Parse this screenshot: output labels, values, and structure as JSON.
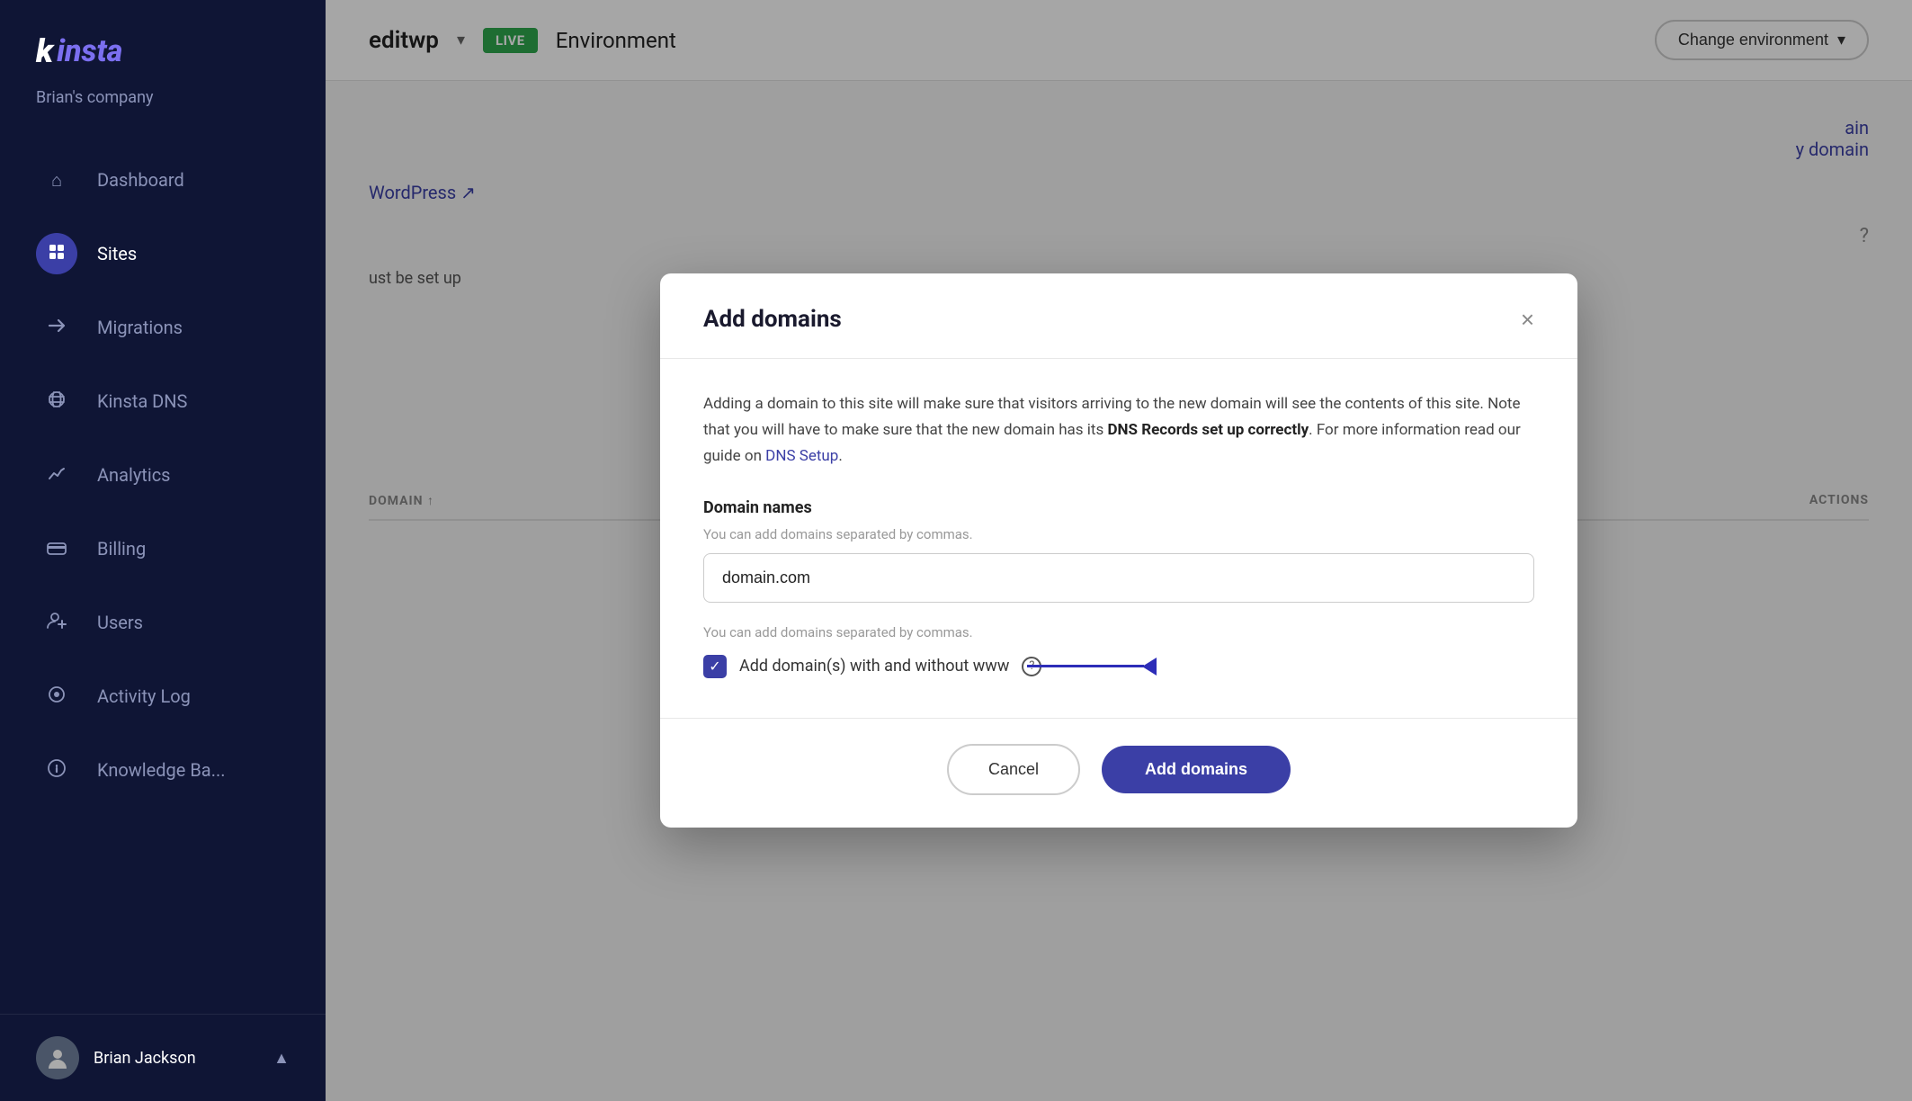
{
  "sidebar": {
    "logo": "Kinsta",
    "company": "Brian's company",
    "nav_items": [
      {
        "id": "dashboard",
        "label": "Dashboard",
        "icon": "⌂",
        "active": false
      },
      {
        "id": "sites",
        "label": "Sites",
        "icon": "◈",
        "active": true
      },
      {
        "id": "migrations",
        "label": "Migrations",
        "icon": "→",
        "active": false
      },
      {
        "id": "kinsta-dns",
        "label": "Kinsta DNS",
        "icon": "⇆",
        "active": false
      },
      {
        "id": "analytics",
        "label": "Analytics",
        "icon": "↗",
        "active": false
      },
      {
        "id": "billing",
        "label": "Billing",
        "icon": "▭",
        "active": false
      },
      {
        "id": "users",
        "label": "Users",
        "icon": "👤",
        "active": false
      },
      {
        "id": "activity-log",
        "label": "Activity Log",
        "icon": "👁",
        "active": false
      },
      {
        "id": "knowledge-base",
        "label": "Knowledge Ba...",
        "icon": "?",
        "active": false
      }
    ],
    "footer": {
      "user": "Brian Jackson",
      "chevron": "▲"
    }
  },
  "header": {
    "site_name": "editwp",
    "chevron": "▾",
    "live_badge": "LIVE",
    "env_label": "Environment",
    "change_env_label": "Change environment",
    "change_env_chevron": "▾"
  },
  "table": {
    "col_domain": "DOMAIN ↑",
    "col_actions": "ACTIONS"
  },
  "modal": {
    "title": "Add domains",
    "close_label": "×",
    "description_text": "Adding a domain to this site will make sure that visitors arriving to the new domain will see the contents of this site. Note that you will have to make sure that the new domain has its ",
    "description_bold": "DNS Records set up correctly",
    "description_text2": ". For more information read our guide on ",
    "dns_link_text": "DNS Setup",
    "description_end": ".",
    "domain_names_label": "Domain names",
    "domain_hint": "You can add domains separated by commas.",
    "domain_input_value": "domain.com",
    "domain_hint2": "You can add domains separated by commas.",
    "checkbox_label": "Add domain(s) with and without www",
    "cancel_label": "Cancel",
    "add_domains_label": "Add domains"
  }
}
